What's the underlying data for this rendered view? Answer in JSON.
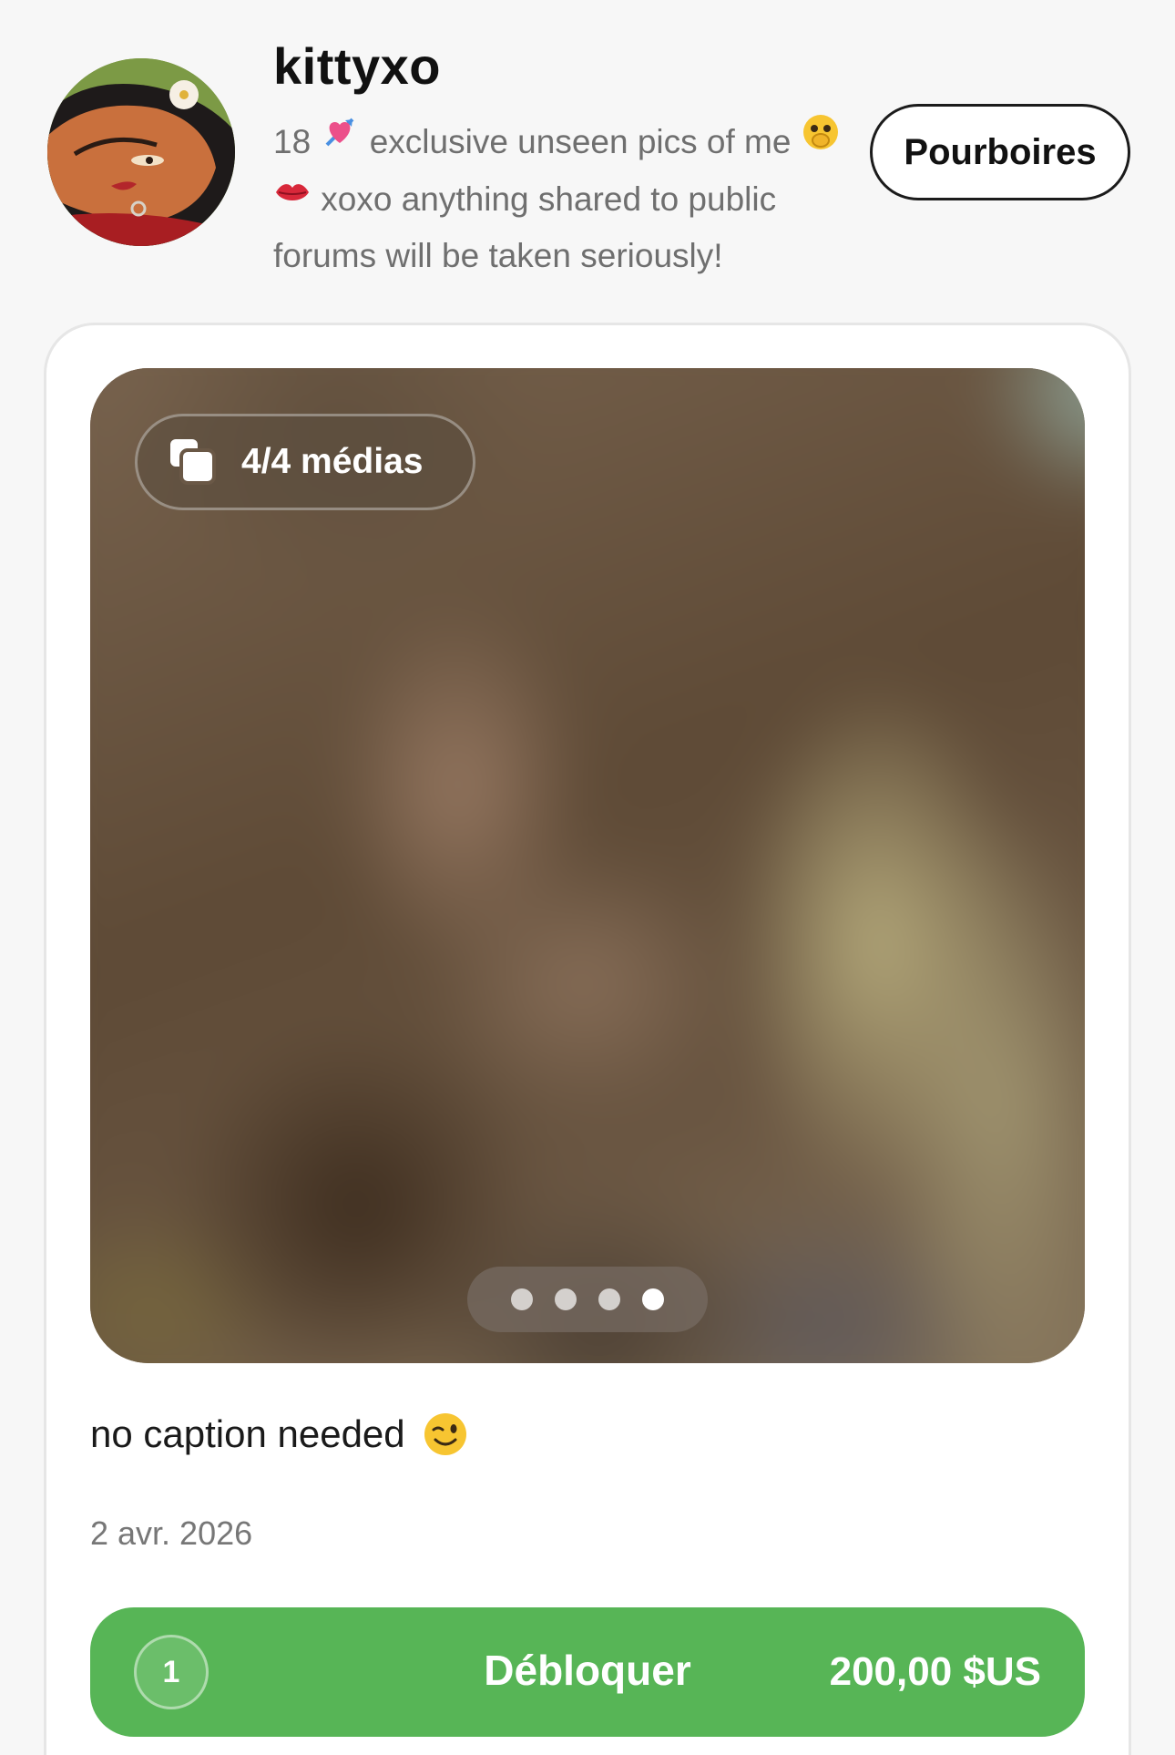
{
  "profile": {
    "username": "kittyxo",
    "bio_line1_prefix": "18",
    "bio_line1_text": "exclusive unseen pics of me",
    "bio_line2_text": "xoxo anything shared to public",
    "bio_line3_text": "forums will be taken seriously!",
    "bio_emojis": [
      "heart-arrow-emoji",
      "face-with-open-eyes-and-hand-over-mouth-emoji",
      "kiss-mark-emoji"
    ],
    "tip_button_label": "Pourboires"
  },
  "post": {
    "media_count_label": "4/4 médias",
    "media_count_icon": "media-stack-icon",
    "carousel": {
      "total": 4,
      "active_index": 4
    },
    "caption_text": "no caption needed",
    "caption_emoji": "winking-face-emoji",
    "date": "2 avr. 2026",
    "unlock": {
      "count": "1",
      "label": "Débloquer",
      "price": "200,00 $US",
      "color": "#57b556"
    }
  }
}
